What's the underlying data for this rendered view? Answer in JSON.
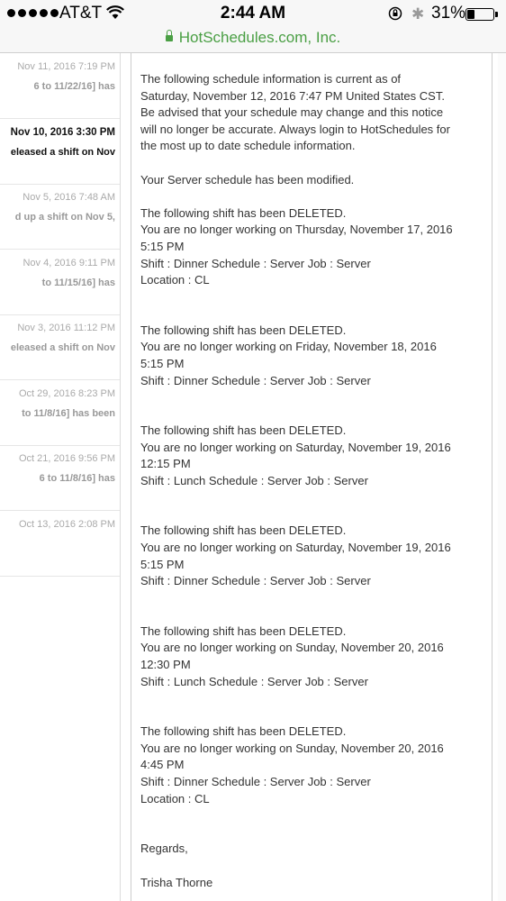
{
  "status_bar": {
    "carrier": "AT&T",
    "time": "2:44 AM",
    "battery": "31%",
    "battery_level": 0.31,
    "url": "HotSchedules.com, Inc."
  },
  "message_list": [
    {
      "date": "Nov 11, 2016 7:19 PM",
      "preview": "6 to 11/22/16] has",
      "unread": false
    },
    {
      "date": "Nov 10, 2016 3:30 PM",
      "preview": "eleased a shift on Nov",
      "unread": true
    },
    {
      "date": "Nov 5, 2016 7:48 AM",
      "preview": "d up a shift on Nov 5,",
      "unread": false
    },
    {
      "date": "Nov 4, 2016 9:11 PM",
      "preview": "to 11/15/16] has",
      "unread": false
    },
    {
      "date": "Nov 3, 2016 11:12 PM",
      "preview": "eleased a shift on Nov",
      "unread": false
    },
    {
      "date": "Oct 29, 2016 8:23 PM",
      "preview": "to 11/8/16] has been",
      "unread": false
    },
    {
      "date": "Oct 21, 2016 9:56 PM",
      "preview": "6 to 11/8/16] has",
      "unread": false
    },
    {
      "date": "Oct 13, 2016 2:08 PM",
      "preview": "",
      "unread": false
    }
  ],
  "email": {
    "intro": "The following schedule information is current as of\nSaturday, November 12, 2016 7:47 PM United States CST.\nBe advised that your schedule may change and this notice\nwill no longer be accurate. Always login to HotSchedules for\nthe most up to date schedule information.",
    "modified": "Your Server schedule has been modified.",
    "shifts": [
      "The following shift has been DELETED.\nYou are no longer working on Thursday, November 17, 2016\n5:15 PM\nShift : Dinner Schedule : Server Job : Server\nLocation : CL",
      "The following shift has been DELETED.\nYou are no longer working on Friday, November 18, 2016\n5:15 PM\nShift : Dinner Schedule : Server Job : Server",
      "The following shift has been DELETED.\nYou are no longer working on Saturday, November 19, 2016\n12:15 PM\nShift : Lunch Schedule : Server Job : Server",
      "The following shift has been DELETED.\nYou are no longer working on Saturday, November 19, 2016\n5:15 PM\nShift : Dinner Schedule : Server Job : Server",
      "The following shift has been DELETED.\nYou are no longer working on Sunday, November 20, 2016\n12:30 PM\nShift : Lunch Schedule : Server Job : Server",
      "The following shift has been DELETED.\nYou are no longer working on Sunday, November 20, 2016\n4:45 PM\nShift : Dinner Schedule : Server Job : Server\nLocation : CL"
    ],
    "regards": "Regards,",
    "signature": "Trisha Thorne"
  }
}
